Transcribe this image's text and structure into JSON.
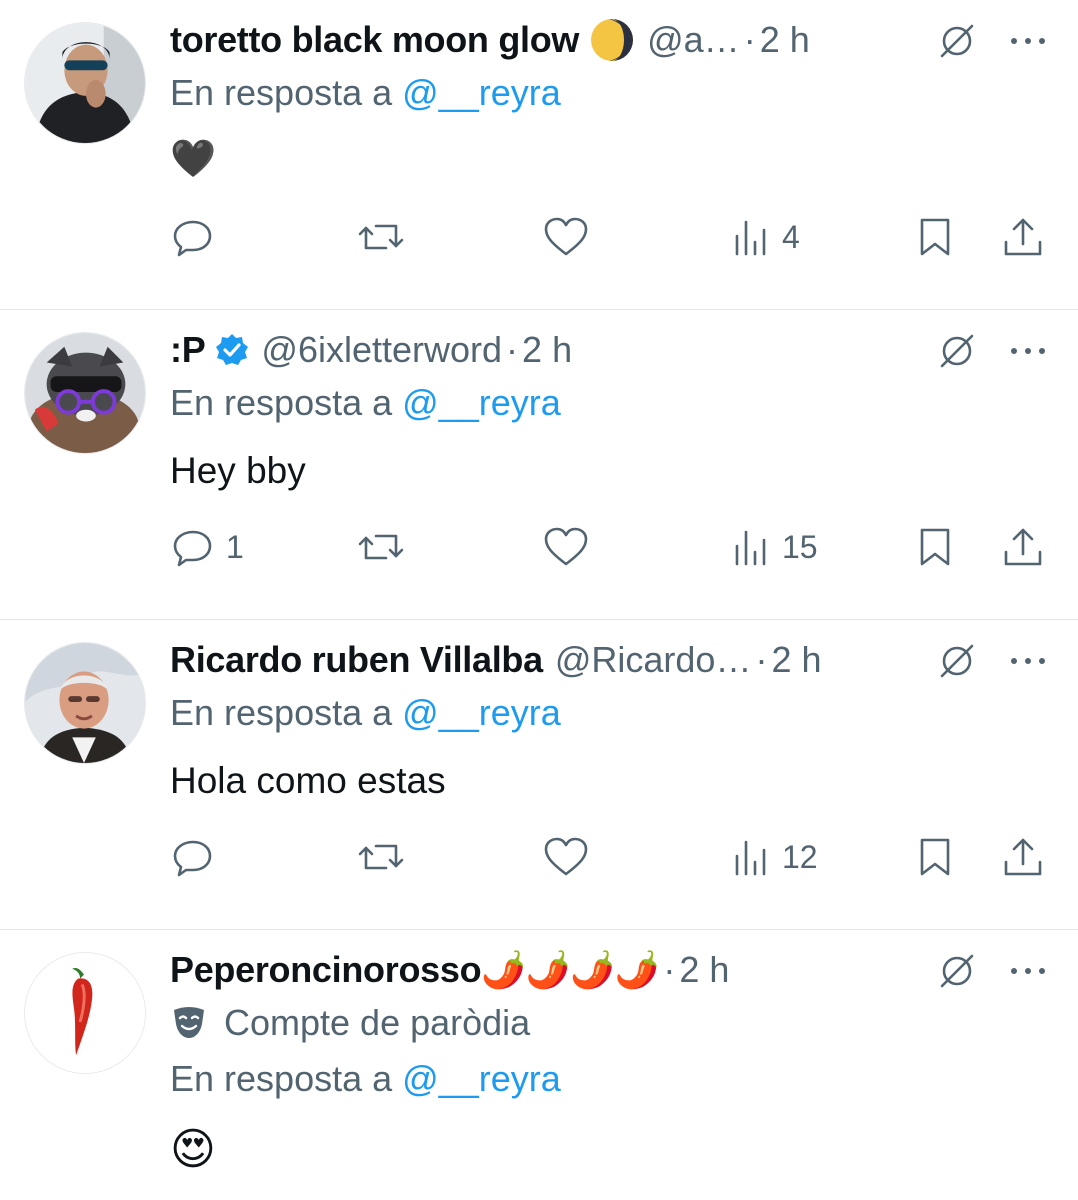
{
  "colors": {
    "accent": "#1d9bf0",
    "text": "#0f1419",
    "secondary": "#536471",
    "divider": "#e4e7ea"
  },
  "tweets": [
    {
      "name": "toretto black moon glow",
      "badge": "moon-emoji",
      "handle": "@a…",
      "dot": "·",
      "time": "2 h",
      "reply_prefix": "En resposta a",
      "reply_to": "@__reyra",
      "content": "🖤",
      "counts": {
        "reply": "",
        "retweet": "",
        "like": "",
        "views": "4"
      }
    },
    {
      "name": ":P",
      "badge": "verified-badge",
      "handle": "@6ixletterword",
      "dot": "·",
      "time": "2 h",
      "reply_prefix": "En resposta a",
      "reply_to": "@__reyra",
      "content": "Hey bby",
      "counts": {
        "reply": "1",
        "retweet": "",
        "like": "",
        "views": "15"
      }
    },
    {
      "name": "Ricardo ruben Villalba",
      "handle": "@Ricardo…",
      "dot": "·",
      "time": "2 h",
      "reply_prefix": "En resposta a",
      "reply_to": "@__reyra",
      "content": "Hola como estas",
      "counts": {
        "reply": "",
        "retweet": "",
        "like": "",
        "views": "12"
      }
    },
    {
      "name": "Peperoncinorosso🌶️🌶️🌶️🌶️",
      "handle": "",
      "dot": "·",
      "time": "2 h",
      "parody_label": "Compte de paròdia",
      "reply_prefix": "En resposta a",
      "reply_to": "@__reyra",
      "content": "😍"
    }
  ]
}
